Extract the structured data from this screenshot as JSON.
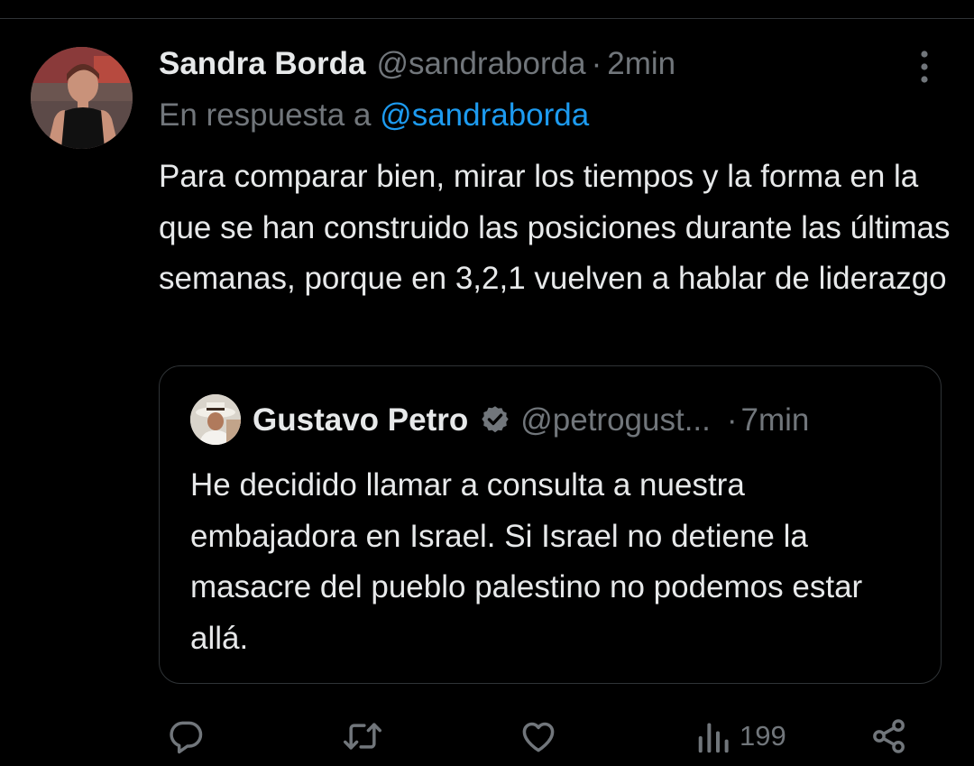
{
  "tweet": {
    "author_name": "Sandra Borda",
    "author_handle": "@sandraborda",
    "separator": "·",
    "time": "2min",
    "reply_prefix": "En respuesta a",
    "reply_mention": "@sandraborda",
    "text": "Para comparar bien, mirar los tiempos y la forma en la que se han construido las posiciones durante las últimas semanas, porque en 3,2,1 vuelven a hablar de liderazgo"
  },
  "quote": {
    "author_name": "Gustavo Petro",
    "author_handle": "@petrogust...",
    "separator": "·",
    "time": "7min",
    "text": "He decidido llamar a consulta a nuestra embajadora en Israel. Si Israel no detiene la masacre del pueblo palestino no podemos estar allá.",
    "verified": true
  },
  "actions": {
    "icons": [
      "reply-icon",
      "retweet-icon",
      "like-icon",
      "views-icon",
      "share-icon"
    ],
    "views_count": "199"
  },
  "colors": {
    "background": "#000000",
    "text_primary": "#e7e9ea",
    "text_secondary": "#71767b",
    "link": "#1d9bf0",
    "border": "#2f3336"
  }
}
